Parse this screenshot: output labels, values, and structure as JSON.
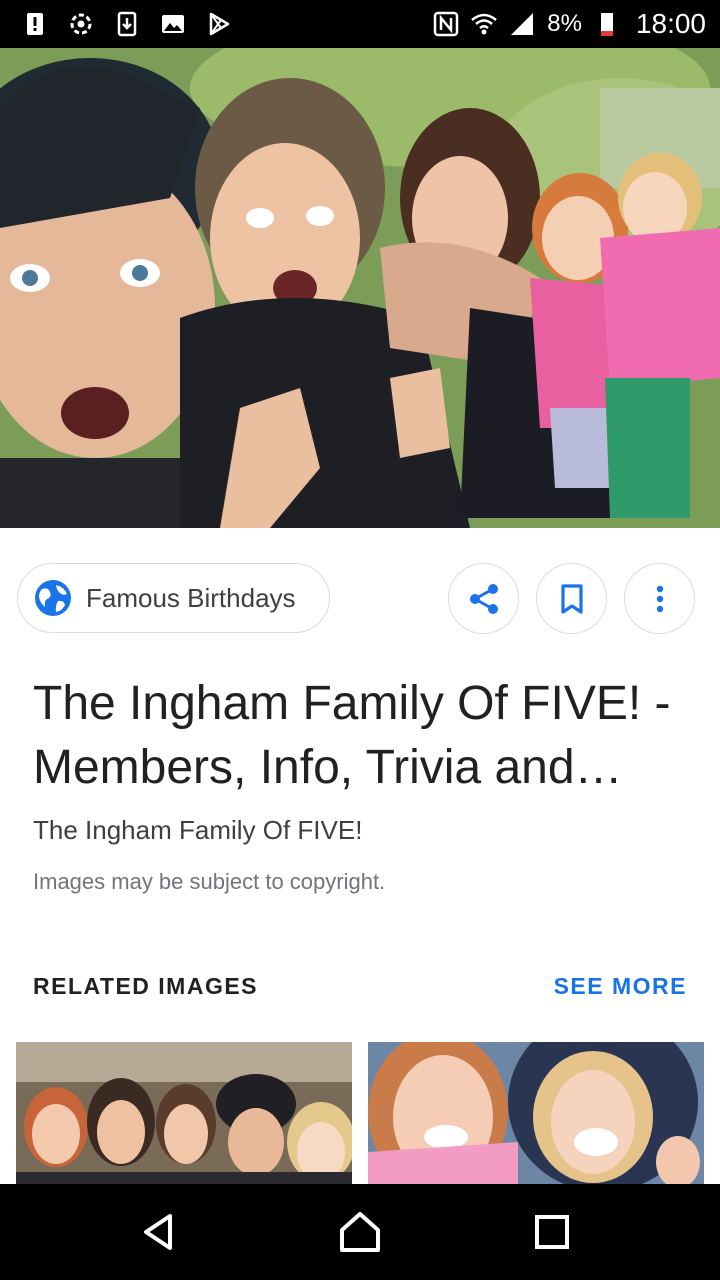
{
  "status_bar": {
    "battery_percent": "8%",
    "time": "18:00",
    "left_icons": [
      "alert-icon",
      "settings-sync-icon",
      "download-icon",
      "image-icon",
      "play-store-icon"
    ],
    "right_icons": [
      "nfc-icon",
      "wifi-icon",
      "signal-icon",
      "battery-low-icon"
    ]
  },
  "hero": {
    "image": "group-selfie-photo"
  },
  "source": {
    "label": "Famous Birthdays",
    "icon": "globe-icon"
  },
  "actions": {
    "share_icon": "share-icon",
    "save_icon": "bookmark-icon",
    "more_icon": "more-vert-icon"
  },
  "result": {
    "title": "The Ingham Family Of FIVE! - Members, Info, Trivia and More",
    "subtitle": "The Ingham Family Of FIVE!",
    "copyright": "Images may be subject to copyright."
  },
  "related": {
    "heading": "RELATED IMAGES",
    "see_more": "SEE MORE",
    "thumbnails": [
      "family-group-photo",
      "two-girls-smiling-photo"
    ]
  },
  "colors": {
    "accent": "#1a73e8",
    "status_bar_bg": "#000000",
    "battery_low": "#e53935"
  }
}
